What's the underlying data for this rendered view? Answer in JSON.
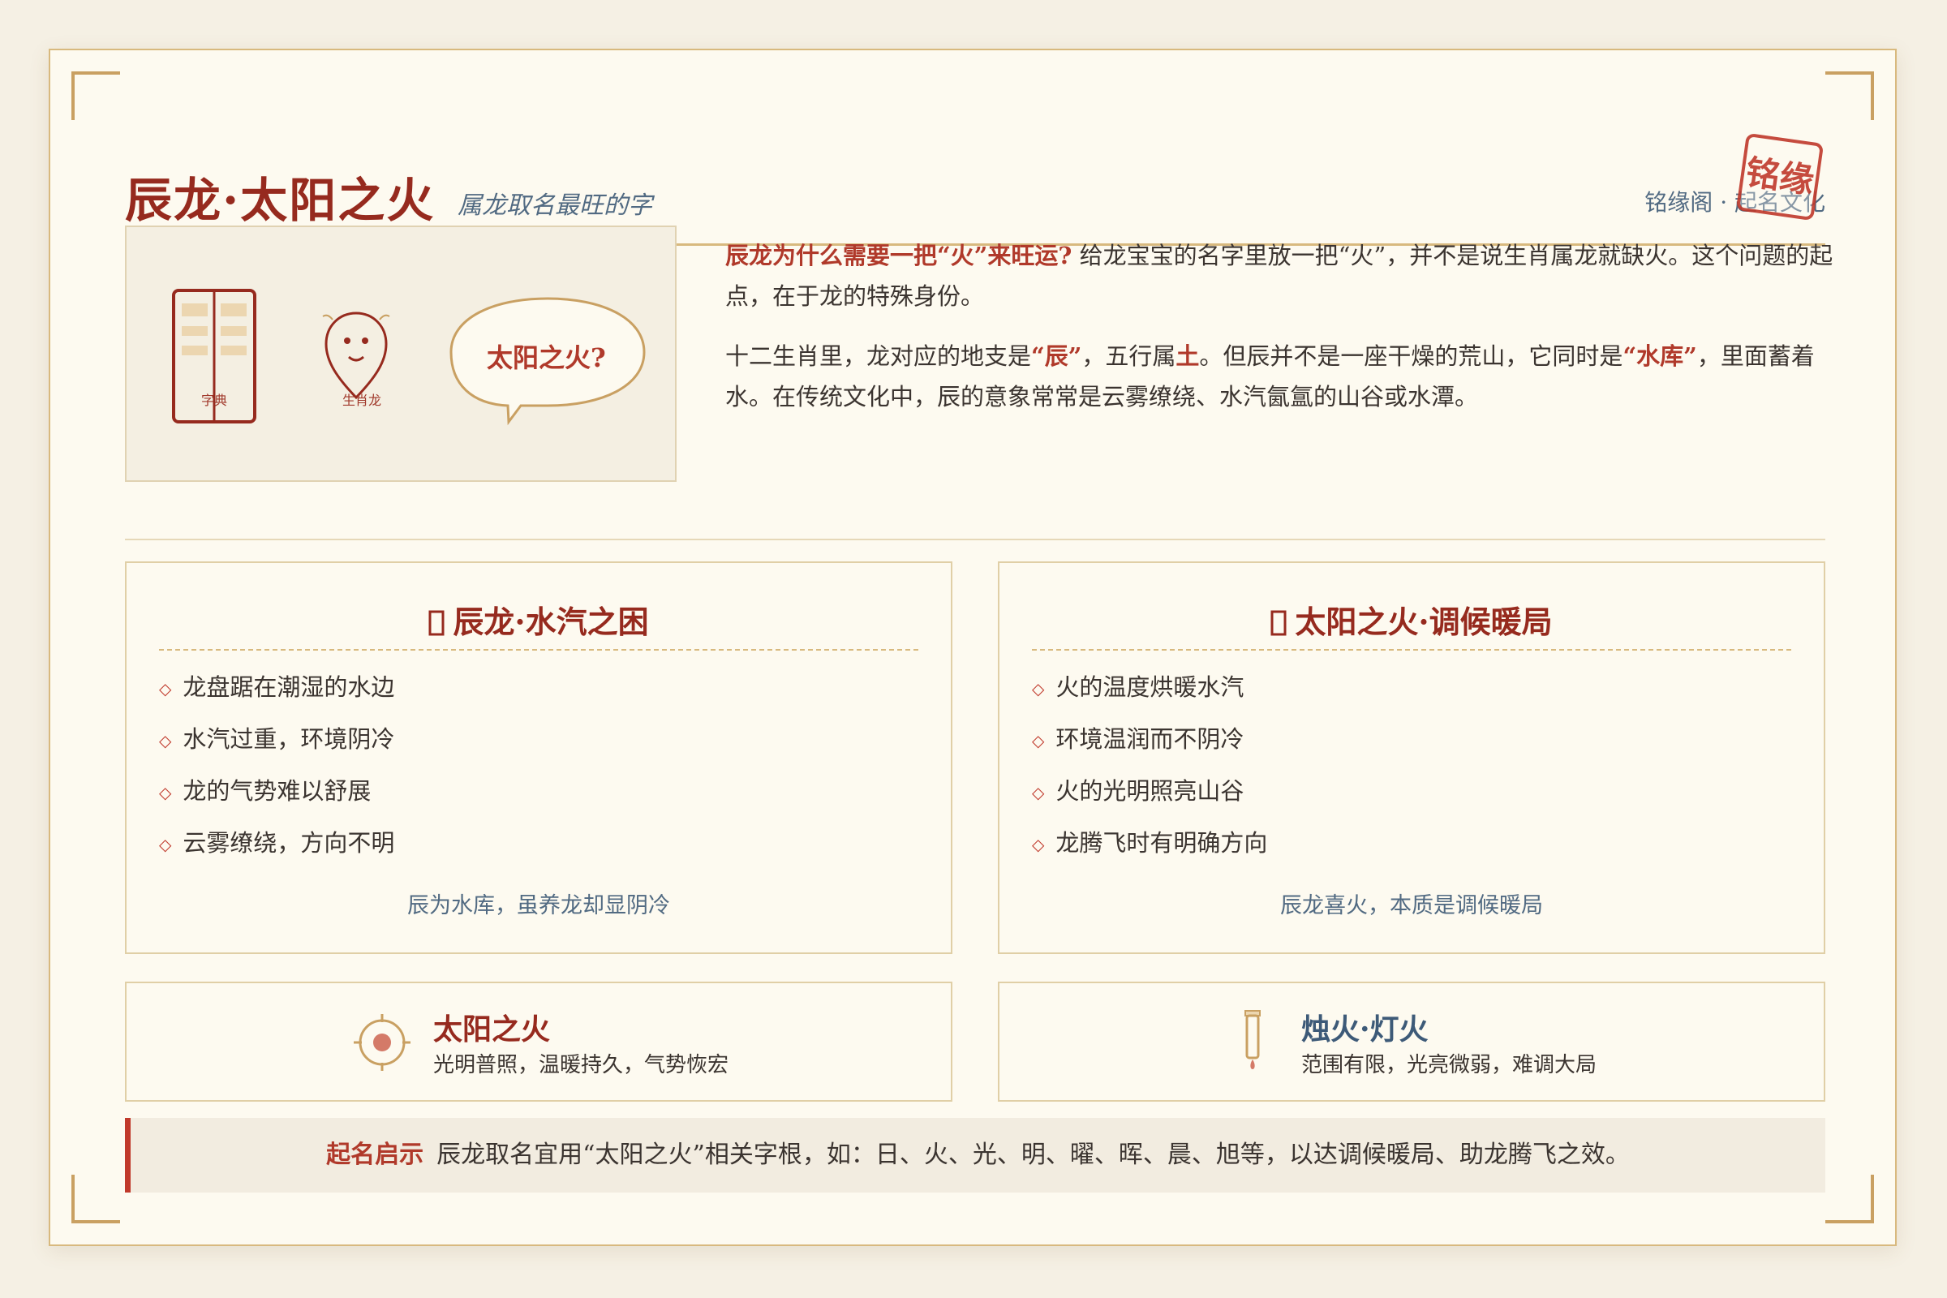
{
  "header": {
    "title": "辰龙·太阳之火",
    "subtitle": "属龙取名最旺的字",
    "brand": "铭缘阁 · 起名文化",
    "seal": "铭缘"
  },
  "illustration": {
    "book_label": "字典",
    "zodiac_label": "生肖龙",
    "bubble": "太阳之火?"
  },
  "intro": {
    "p1_lead": "辰龙为什么需要一把“火”来旺运?",
    "p1_text": " 给龙宝宝的名字里放一把“火”，并不是说生肖属龙就缺火。这个问题的起点，在于龙的特殊身份。",
    "p2_a": "十二生肖里，龙对应的地支是",
    "p2_b": "“辰”",
    "p2_c": "，五行属",
    "p2_d": "土",
    "p2_e": "。但辰并不是一座干燥的荒山，它同时是",
    "p2_f": "“水库”",
    "p2_g": "，里面蓄着水。在传统文化中，辰的意象常常是云雾缭绕、水汽氤氲的山谷或水潭。"
  },
  "cards": {
    "left": {
      "icon": "missing-glyph-icon",
      "title": "辰龙·水汽之困",
      "items": [
        "龙盘踞在潮湿的水边",
        "水汽过重，环境阴冷",
        "龙的气势难以舒展",
        "云雾缭绕，方向不明"
      ],
      "footer": "辰为水库，虽养龙却显阴冷"
    },
    "right": {
      "icon": "missing-glyph-icon",
      "title": "太阳之火·调候暖局",
      "items": [
        "火的温度烘暖水汽",
        "环境温润而不阴冷",
        "火的光明照亮山谷",
        "龙腾飞时有明确方向"
      ],
      "footer": "辰龙喜火，本质是调候暖局"
    }
  },
  "compare": {
    "sun": {
      "icon": "sun-icon",
      "title": "太阳之火",
      "desc": "光明普照，温暖持久，气势恢宏",
      "color": "#962a1e"
    },
    "candle": {
      "icon": "candle-icon",
      "title": "烛火·灯火",
      "desc": "范围有限，光亮微弱，难调大局",
      "color": "#3d5a78"
    }
  },
  "tip": {
    "label": "起名启示",
    "text": "辰龙取名宜用“太阳之火”相关字根，如：日、火、光、明、曜、晖、晨、旭等，以达调候暖局、助龙腾飞之效。"
  },
  "colors": {
    "accent": "#962a1e",
    "gold": "#d8b97e",
    "blue": "#516a82",
    "paper": "#fdfaf0"
  }
}
